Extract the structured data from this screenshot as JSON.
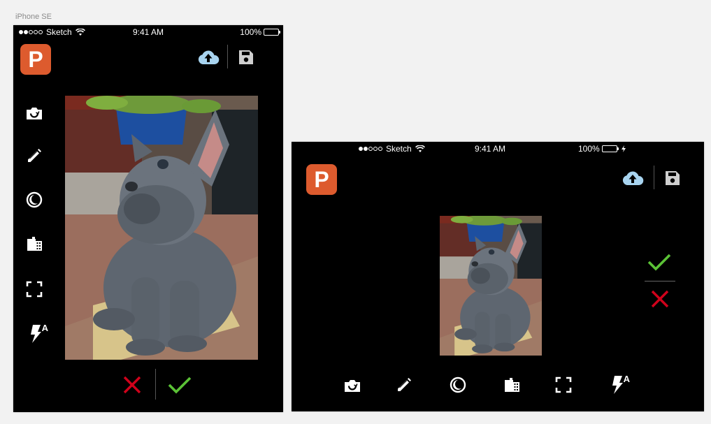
{
  "artboard": {
    "label": "iPhone SE"
  },
  "portrait": {
    "status": {
      "carrier": "Sketch",
      "time": "9:41 AM",
      "battery": "100%",
      "signal_bars": 2,
      "battery_level": 1.0
    },
    "logo": {
      "letter": "P"
    },
    "toolbar": {
      "icons": [
        "upload-cloud-icon",
        "save-disk-icon"
      ]
    },
    "tools": [
      "camera-switch-icon",
      "pencil-icon",
      "exposure-icon",
      "film-roll-icon",
      "crop-frame-icon",
      "flash-auto-icon"
    ],
    "flash_label": "A",
    "actions": {
      "cancel": "cancel-x-icon",
      "confirm": "confirm-check-icon"
    }
  },
  "landscape": {
    "status": {
      "carrier": "Sketch",
      "time": "9:41 AM",
      "battery": "100%",
      "signal_bars": 2,
      "battery_level": 1.0,
      "charging": true
    },
    "logo": {
      "letter": "P"
    },
    "toolbar": {
      "icons": [
        "upload-cloud-icon",
        "save-disk-icon"
      ]
    },
    "tools": [
      "camera-switch-icon",
      "pencil-icon",
      "exposure-icon",
      "film-roll-icon",
      "crop-frame-icon",
      "flash-auto-icon"
    ],
    "flash_label": "A",
    "actions": {
      "confirm": "confirm-check-icon",
      "cancel": "cancel-x-icon"
    }
  },
  "colors": {
    "logo": "#dd5b2e",
    "upload": "#a8d4f0",
    "confirm": "#5bc236",
    "cancel": "#d0021b",
    "battery": "#4cd964"
  }
}
